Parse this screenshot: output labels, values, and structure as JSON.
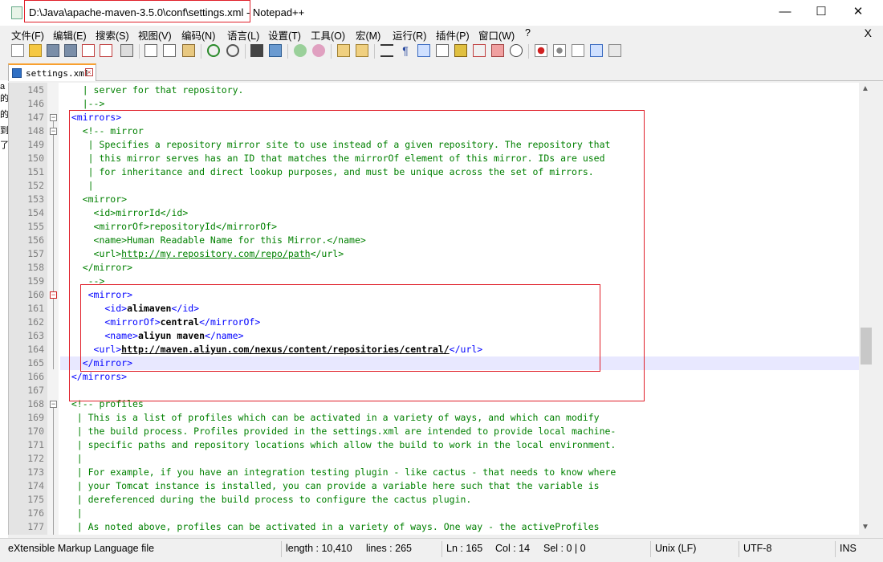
{
  "window": {
    "title": "D:\\Java\\apache-maven-3.5.0\\conf\\settings.xml",
    "title_suffix": " - Notepad++",
    "minimize": "—",
    "maximize": "☐",
    "close": "✕"
  },
  "menu": {
    "items": [
      "文件(F)",
      "编辑(E)",
      "搜索(S)",
      "视图(V)",
      "编码(N)",
      "语言(L)",
      "设置(T)",
      "工具(O)",
      "宏(M)",
      "运行(R)",
      "插件(P)",
      "窗口(W)",
      "?"
    ],
    "close": "X"
  },
  "tab": {
    "label": "settings.xml",
    "close": "×"
  },
  "left_edge_chars": [
    "a",
    "的",
    "的",
    "到",
    "了"
  ],
  "editor": {
    "lines": [
      {
        "n": "145",
        "segs": [
          {
            "c": "t-cmt",
            "t": "    | server for that repository."
          }
        ]
      },
      {
        "n": "146",
        "segs": [
          {
            "c": "t-cmt",
            "t": "    |-->"
          }
        ]
      },
      {
        "n": "147",
        "segs": [
          {
            "c": "t-tag",
            "t": "  <mirrors>"
          }
        ]
      },
      {
        "n": "148",
        "segs": [
          {
            "c": "t-cmt",
            "t": "    <!-- mirror"
          }
        ]
      },
      {
        "n": "149",
        "segs": [
          {
            "c": "t-cmt",
            "t": "     | Specifies a repository mirror site to use instead of a given repository. The repository that"
          }
        ]
      },
      {
        "n": "150",
        "segs": [
          {
            "c": "t-cmt",
            "t": "     | this mirror serves has an ID that matches the mirrorOf element of this mirror. IDs are used"
          }
        ]
      },
      {
        "n": "151",
        "segs": [
          {
            "c": "t-cmt",
            "t": "     | for inheritance and direct lookup purposes, and must be unique across the set of mirrors."
          }
        ]
      },
      {
        "n": "152",
        "segs": [
          {
            "c": "t-cmt",
            "t": "     |"
          }
        ]
      },
      {
        "n": "153",
        "segs": [
          {
            "c": "t-cmt",
            "t": "    <mirror>"
          }
        ]
      },
      {
        "n": "154",
        "segs": [
          {
            "c": "t-cmt",
            "t": "      <id>mirrorId</id>"
          }
        ]
      },
      {
        "n": "155",
        "segs": [
          {
            "c": "t-cmt",
            "t": "      <mirrorOf>repositoryId</mirrorOf>"
          }
        ]
      },
      {
        "n": "156",
        "segs": [
          {
            "c": "t-cmt",
            "t": "      <name>Human Readable Name for this Mirror.</name>"
          }
        ]
      },
      {
        "n": "157",
        "segs": [
          {
            "c": "t-cmt",
            "t": "      <url>"
          },
          {
            "c": "t-url",
            "t": "http://my.repository.com/repo/path"
          },
          {
            "c": "t-cmt",
            "t": "</url>"
          }
        ]
      },
      {
        "n": "158",
        "segs": [
          {
            "c": "t-cmt",
            "t": "    </mirror>"
          }
        ]
      },
      {
        "n": "159",
        "segs": [
          {
            "c": "t-cmt",
            "t": "     -->"
          }
        ]
      },
      {
        "n": "160",
        "segs": [
          {
            "c": "t-tag",
            "t": "     <mirror>"
          }
        ]
      },
      {
        "n": "161",
        "segs": [
          {
            "c": "t-tag",
            "t": "        <id>"
          },
          {
            "c": "t-txt",
            "t": "alimaven"
          },
          {
            "c": "t-tag",
            "t": "</id>"
          }
        ]
      },
      {
        "n": "162",
        "segs": [
          {
            "c": "t-tag",
            "t": "        <mirrorOf>"
          },
          {
            "c": "t-txt",
            "t": "central"
          },
          {
            "c": "t-tag",
            "t": "</mirrorOf>"
          }
        ]
      },
      {
        "n": "163",
        "segs": [
          {
            "c": "t-tag",
            "t": "        <name>"
          },
          {
            "c": "t-txt",
            "t": "aliyun maven"
          },
          {
            "c": "t-tag",
            "t": "</name>"
          }
        ]
      },
      {
        "n": "164",
        "segs": [
          {
            "c": "t-tag",
            "t": "      <url>"
          },
          {
            "c": "t-urlb",
            "t": "http://maven.aliyun.com/nexus/content/repositories/central/"
          },
          {
            "c": "t-tag",
            "t": "</url>"
          }
        ]
      },
      {
        "n": "165",
        "segs": [
          {
            "c": "t-tag",
            "t": "    </mirror>"
          }
        ]
      },
      {
        "n": "166",
        "segs": [
          {
            "c": "t-tag",
            "t": "  </mirrors>"
          }
        ]
      },
      {
        "n": "167",
        "segs": [
          {
            "c": "t-plain",
            "t": ""
          }
        ]
      },
      {
        "n": "168",
        "segs": [
          {
            "c": "t-cmt",
            "t": "  <!-- profiles"
          }
        ]
      },
      {
        "n": "169",
        "segs": [
          {
            "c": "t-cmt",
            "t": "   | This is a list of profiles which can be activated in a variety of ways, and which can modify"
          }
        ]
      },
      {
        "n": "170",
        "segs": [
          {
            "c": "t-cmt",
            "t": "   | the build process. Profiles provided in the settings.xml are intended to provide local machine-"
          }
        ]
      },
      {
        "n": "171",
        "segs": [
          {
            "c": "t-cmt",
            "t": "   | specific paths and repository locations which allow the build to work in the local environment."
          }
        ]
      },
      {
        "n": "172",
        "segs": [
          {
            "c": "t-cmt",
            "t": "   |"
          }
        ]
      },
      {
        "n": "173",
        "segs": [
          {
            "c": "t-cmt",
            "t": "   | For example, if you have an integration testing plugin - like cactus - that needs to know where"
          }
        ]
      },
      {
        "n": "174",
        "segs": [
          {
            "c": "t-cmt",
            "t": "   | your Tomcat instance is installed, you can provide a variable here such that the variable is"
          }
        ]
      },
      {
        "n": "175",
        "segs": [
          {
            "c": "t-cmt",
            "t": "   | dereferenced during the build process to configure the cactus plugin."
          }
        ]
      },
      {
        "n": "176",
        "segs": [
          {
            "c": "t-cmt",
            "t": "   |"
          }
        ]
      },
      {
        "n": "177",
        "segs": [
          {
            "c": "t-cmt",
            "t": "   | As noted above, profiles can be activated in a variety of ways. One way - the activeProfiles"
          }
        ]
      }
    ],
    "current_line": "165"
  },
  "status": {
    "language": "eXtensible Markup Language file",
    "length": "length : 10,410",
    "lines": "lines : 265",
    "ln": "Ln : 165",
    "col": "Col : 14",
    "sel": "Sel : 0 | 0",
    "eol": "Unix (LF)",
    "encoding": "UTF-8",
    "mode": "INS"
  },
  "colors": {
    "tag": "#0000ff",
    "comment": "#008000",
    "highlight_box": "#e0202a",
    "current_line_bg": "#e8e8ff"
  }
}
